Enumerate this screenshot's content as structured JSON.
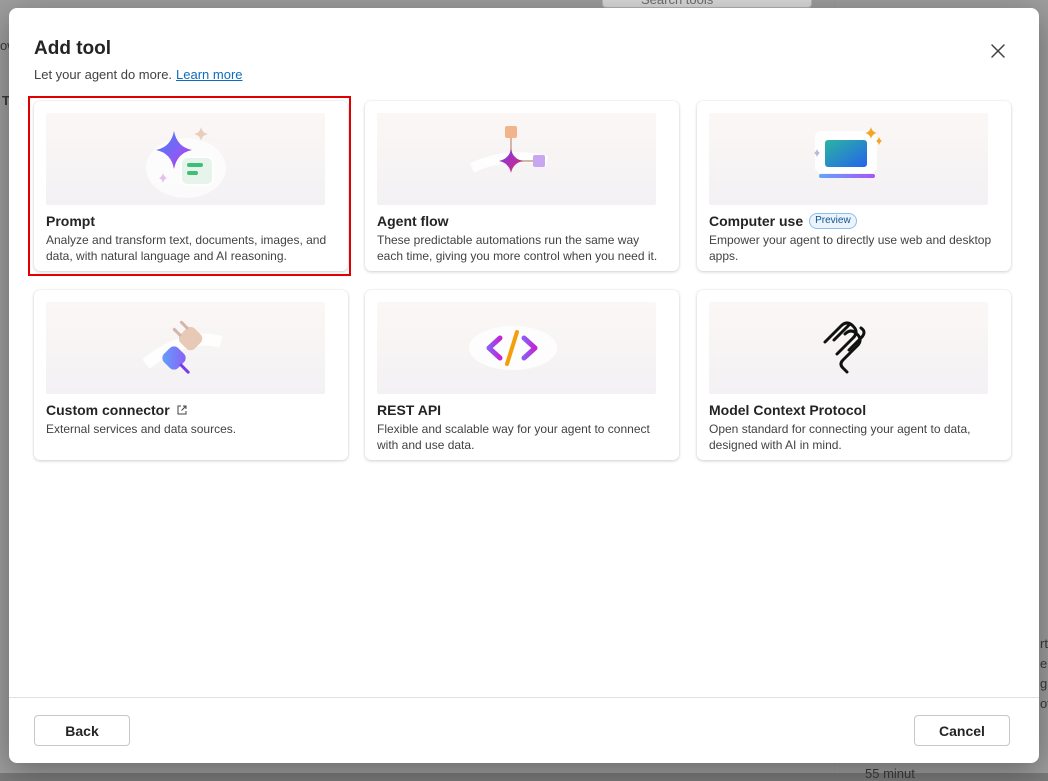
{
  "background": {
    "search_placeholder": "Search tools",
    "fragments": [
      "ow",
      "T",
      "rt",
      "e",
      "g",
      "ov",
      "55 minut"
    ]
  },
  "dialog": {
    "title": "Add tool",
    "subtitle": "Let your agent do more.",
    "learn_more": "Learn more",
    "close_label": "Close"
  },
  "tools": [
    {
      "name": "Prompt",
      "description": "Analyze and transform text, documents, images, and data, with natural language and AI reasoning.",
      "icon": "sparkle-prompt-icon",
      "selected": true
    },
    {
      "name": "Agent flow",
      "description": "These predictable automations run the same way each time, giving you more control when you need it.",
      "icon": "flow-icon"
    },
    {
      "name": "Computer use",
      "badge": "Preview",
      "description": "Empower your agent to directly use web and desktop apps.",
      "icon": "computer-icon"
    },
    {
      "name": "Custom connector",
      "description": "External services and data sources.",
      "icon": "plug-icon",
      "external": true
    },
    {
      "name": "REST API",
      "description": "Flexible and scalable way for your agent to connect with and use data.",
      "icon": "code-icon"
    },
    {
      "name": "Model Context Protocol",
      "description": "Open standard for connecting your agent to data, designed with AI in mind.",
      "icon": "mcp-icon"
    }
  ],
  "footer": {
    "back_label": "Back",
    "cancel_label": "Cancel"
  },
  "colors": {
    "accent_link": "#0f6cbd",
    "highlight": "#e00000"
  }
}
